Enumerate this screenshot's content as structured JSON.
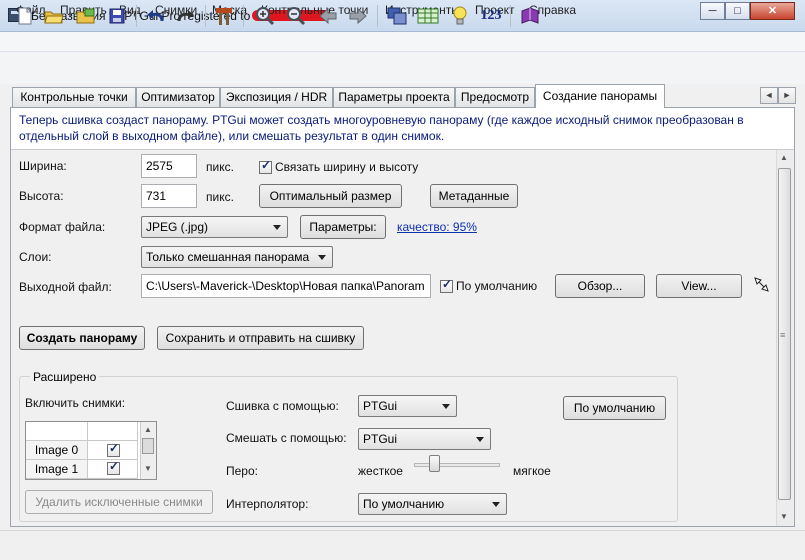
{
  "window": {
    "title": "Без названия * - PTGui Pro registered to",
    "controls": {
      "minimize": "─",
      "maximize": "□",
      "close": "✕"
    }
  },
  "menu": [
    "Файл",
    "Править",
    "Вид",
    "Снимки",
    "Маска",
    "Контрольные точки",
    "Инструменты",
    "Проект",
    "Справка"
  ],
  "toolbar": {
    "icons": [
      "new-file-icon",
      "open-folder-icon",
      "open-images-icon",
      "save-icon",
      "undo-icon",
      "redo-icon",
      "tools-icon",
      "zoom-in-icon",
      "zoom-out-icon",
      "previous-icon",
      "next-icon",
      "panorama-editor-icon",
      "table-icon",
      "bulb-icon",
      "numbers-icon",
      "book-icon"
    ],
    "numbers_label": "123"
  },
  "tabs": [
    "Контрольные точки",
    "Оптимизатор",
    "Экспозиция / HDR",
    "Параметры проекта",
    "Предосмотр",
    "Создание панорамы"
  ],
  "active_tab": "Создание панорамы",
  "info": "Теперь сшивка создаст панораму. PTGui может создать многоуровневую панораму (где каждое исходный снимок преобразован в отдельный слой в выходном файле), или смешать результат в один снимок.",
  "form": {
    "width_label": "Ширина:",
    "width_value": "2575",
    "px1": "пикс.",
    "link_label": "Связать ширину и высоту",
    "link_checked": true,
    "height_label": "Высота:",
    "height_value": "731",
    "px2": "пикс.",
    "optimal_size_button": "Оптимальный размер",
    "metadata_button": "Метаданные",
    "format_label": "Формат файла:",
    "format_value": "JPEG (.jpg)",
    "params_button": "Параметры:",
    "quality_link": "качество: 95%",
    "layers_label": "Слои:",
    "layers_value": "Только смешанная панорама",
    "output_label": "Выходной файл:",
    "output_value": "C:\\Users\\-Maverick-\\Desktop\\Новая папка\\Panoram",
    "default_label": "По умолчанию",
    "default_checked": true,
    "browse_button": "Обзор...",
    "view_button": "View..."
  },
  "actions": {
    "create_button": "Создать панораму",
    "save_send_button": "Сохранить и отправить на сшивку"
  },
  "advanced": {
    "title": "Расширено",
    "include_label": "Включить снимки:",
    "images": [
      {
        "name": "Image 0",
        "checked": true
      },
      {
        "name": "Image 1",
        "checked": true
      }
    ],
    "remove_excluded_button": "Удалить исключенные снимки",
    "stitcher_label": "Сшивка с помощью:",
    "stitcher_value": "PTGui",
    "blender_label": "Смешать с помощью:",
    "blender_value": "PTGui",
    "feather_label": "Перо:",
    "feather_hard": "жесткое",
    "feather_soft": "мягкое",
    "feather_level": 0.2,
    "interpolator_label": "Интерполятор:",
    "interpolator_value": "По умолчанию",
    "defaults_button": "По умолчанию"
  }
}
